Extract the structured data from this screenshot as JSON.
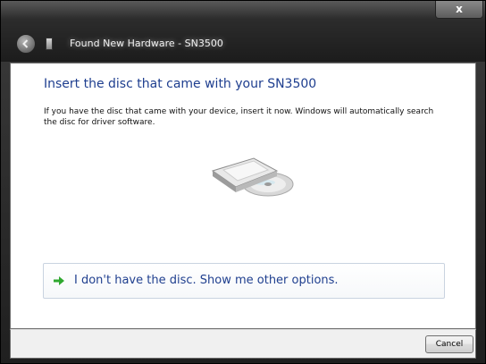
{
  "window": {
    "title": "Found New Hardware - SN3500",
    "close_label": "x"
  },
  "content": {
    "heading": "Insert the disc that came with your SN3500",
    "description": "If you have the disc that came with your device, insert it now.  Windows will automatically search the disc for driver software.",
    "illustration_icon": "optical-drive-with-disc-icon"
  },
  "option": {
    "label": "I don't have the disc.  Show me other options.",
    "icon": "green-arrow-icon"
  },
  "footer": {
    "cancel_label": "Cancel"
  },
  "colors": {
    "heading": "#1e3e8f",
    "link": "#1f3f8f",
    "arrow": "#2fa82f",
    "titlebar": "#2c2c2c"
  }
}
